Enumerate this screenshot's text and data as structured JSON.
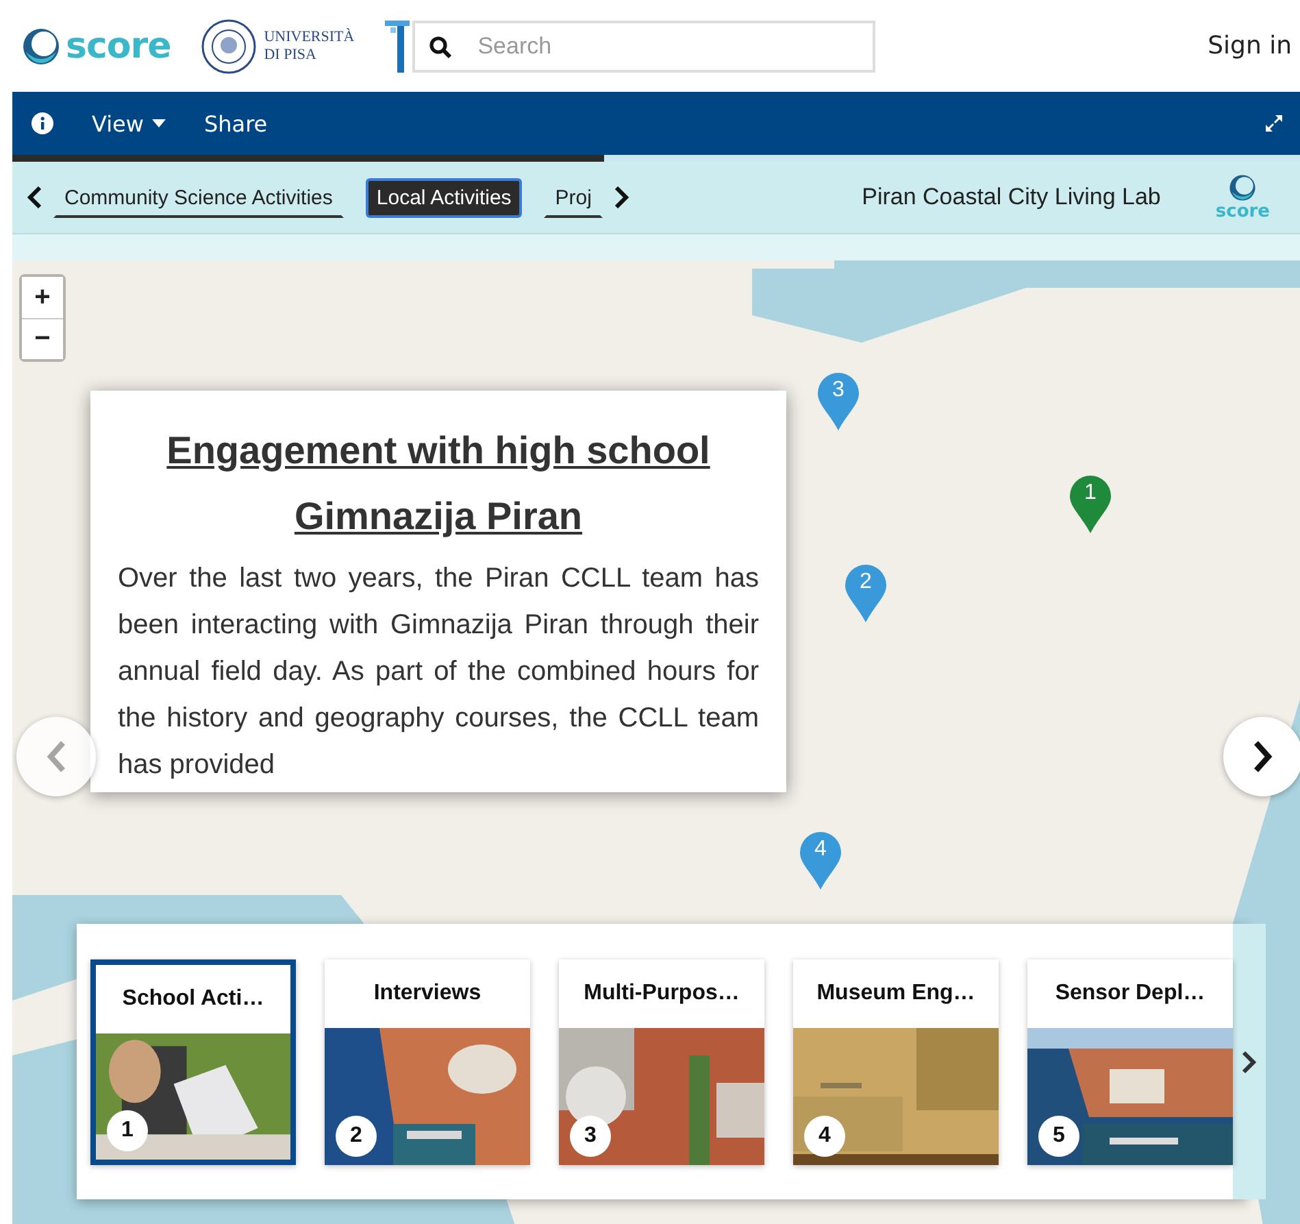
{
  "header": {
    "logo_text": "score",
    "university": [
      "UNIVERSITÀ",
      "DI PISA"
    ],
    "search": {
      "placeholder": "Search"
    },
    "sign_in": "Sign in"
  },
  "toolbar": {
    "items": [
      {
        "kind": "info"
      },
      {
        "kind": "menu",
        "label": "View"
      },
      {
        "kind": "link",
        "label": "Share"
      },
      {
        "kind": "expand"
      }
    ]
  },
  "progress": {
    "level": 0.46
  },
  "tabs": {
    "items": [
      {
        "label": "Community Science Activities",
        "selected": false
      },
      {
        "label": "Local Activities",
        "selected": true
      },
      {
        "label": "Proj",
        "selected": false
      }
    ],
    "title": "Piran Coastal City Living Lab",
    "logo_text": "score"
  },
  "map": {
    "zoom": [
      "+",
      "−"
    ],
    "pins": [
      {
        "label": "3",
        "color": "#3a9ad9"
      },
      {
        "label": "2",
        "color": "#3a9ad9"
      },
      {
        "label": "4",
        "color": "#3a9ad9"
      },
      {
        "label": "1",
        "color": "#1f8a3c"
      }
    ]
  },
  "story": {
    "title": "Engagement with high school Gimnazija Piran",
    "body": "Over the last two years, the Piran CCLL team has been interacting with Gimnazija Piran through their annual field day. As part of the combined hours for the history and geography courses, the CCLL team has provided"
  },
  "slides": [
    {
      "title": "School Acti…",
      "number": "1",
      "selected": true,
      "kind": "picture"
    },
    {
      "title": "Interviews",
      "number": "2",
      "selected": false,
      "kind": "picture"
    },
    {
      "title": "Multi-Purpos…",
      "number": "3",
      "selected": false,
      "kind": "picture"
    },
    {
      "title": "Museum Eng…",
      "number": "4",
      "selected": false,
      "kind": "picture"
    },
    {
      "title": "Sensor Depl…",
      "number": "5",
      "selected": false,
      "kind": "picture"
    }
  ]
}
